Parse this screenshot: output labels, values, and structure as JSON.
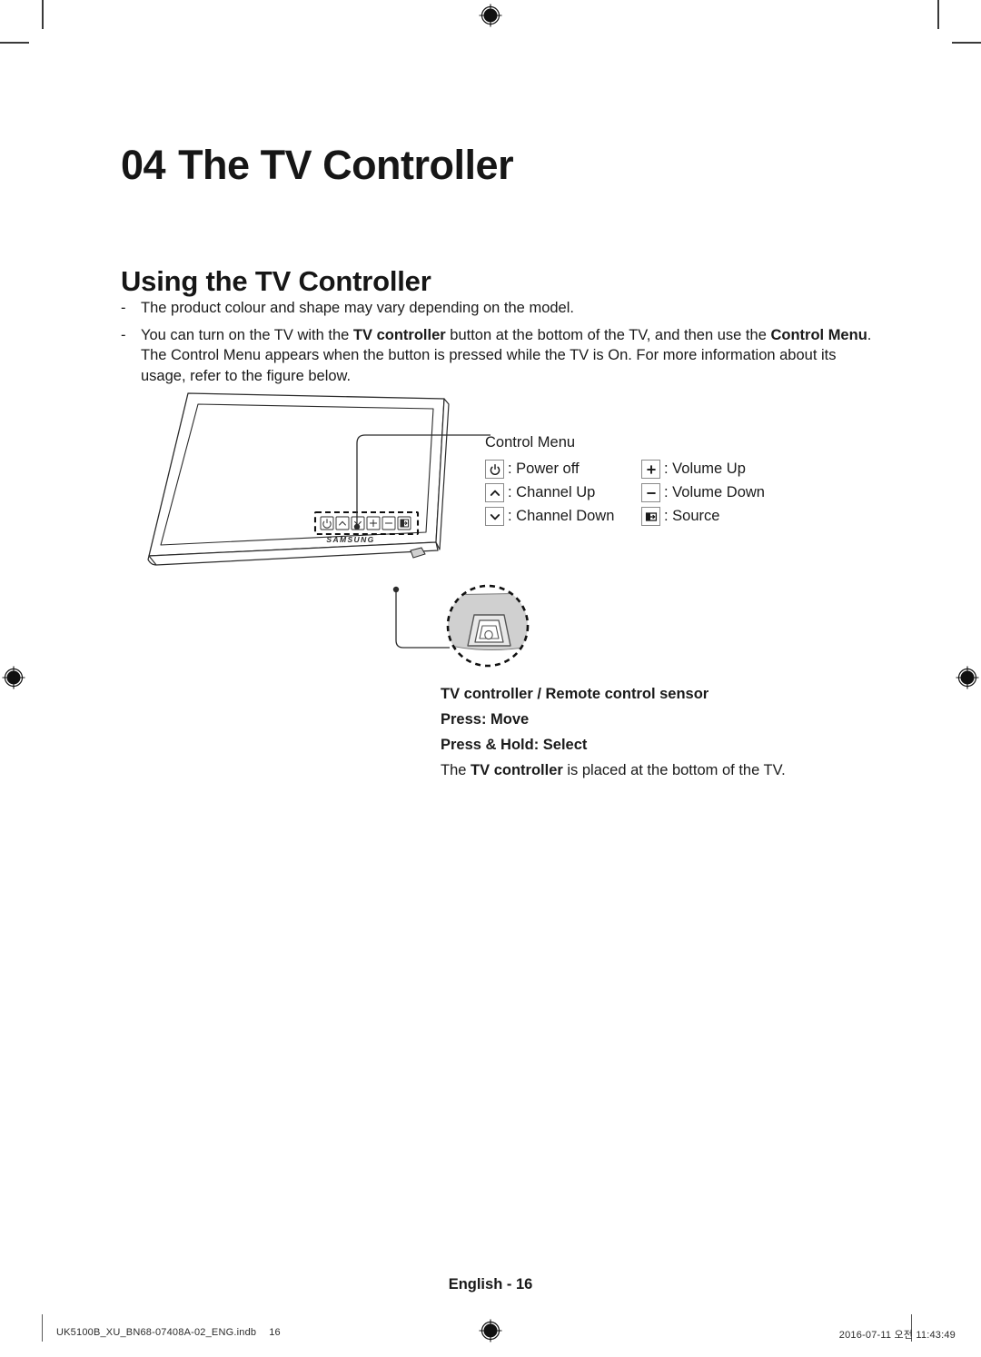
{
  "document": {
    "chapter_number": "04",
    "chapter_title": "The TV Controller",
    "section_title": "Using the TV Controller",
    "page_label": "English - 16"
  },
  "notes": {
    "dash": "-",
    "items": [
      {
        "segments": [
          {
            "text": "The product colour and shape may vary depending on the model.",
            "bold": false
          }
        ]
      },
      {
        "segments": [
          {
            "text": "You can turn on the TV with the ",
            "bold": false
          },
          {
            "text": "TV controller",
            "bold": true
          },
          {
            "text": " button at the bottom of the TV, and then use the ",
            "bold": false
          },
          {
            "text": "Control Menu",
            "bold": true
          },
          {
            "text": ". The Control Menu appears when the button is pressed while the TV is On. For more information about its usage, refer to the figure below.",
            "bold": false
          }
        ]
      }
    ]
  },
  "figure": {
    "tv_brand_logo": "SAMSUNG",
    "onscreen_buttons": [
      {
        "icon": "power-icon"
      },
      {
        "icon": "chevron-up-icon"
      },
      {
        "icon": "chevron-down-icon"
      },
      {
        "icon": "plus-icon"
      },
      {
        "icon": "minus-icon"
      },
      {
        "icon": "source-icon"
      }
    ]
  },
  "control_menu": {
    "title": "Control Menu",
    "items": [
      {
        "icon": "power-icon",
        "label": ": Power off"
      },
      {
        "icon": "plus-icon",
        "label": ": Volume Up"
      },
      {
        "icon": "chevron-up-icon",
        "label": ": Channel Up"
      },
      {
        "icon": "minus-icon",
        "label": ": Volume Down"
      },
      {
        "icon": "chevron-down-icon",
        "label": ": Channel Down"
      },
      {
        "icon": "source-icon",
        "label": ": Source"
      }
    ]
  },
  "caption": {
    "line1": "TV controller / Remote control sensor",
    "line2": "Press: Move",
    "line3": "Press & Hold: Select",
    "line4_pre": "The ",
    "line4_bold": "TV controller",
    "line4_post": " is placed at the bottom of the TV."
  },
  "print_marks": {
    "file_name": "UK5100B_XU_BN68-07408A-02_ENG.indb",
    "file_page": "16",
    "timestamp": "2016-07-11   오전 11:43:49"
  },
  "colors": {
    "text": "#1a1a1a",
    "line_art": "#2b2b2b",
    "detail_fill": "#d0d0d0",
    "key_border": "#8a8a8a"
  }
}
